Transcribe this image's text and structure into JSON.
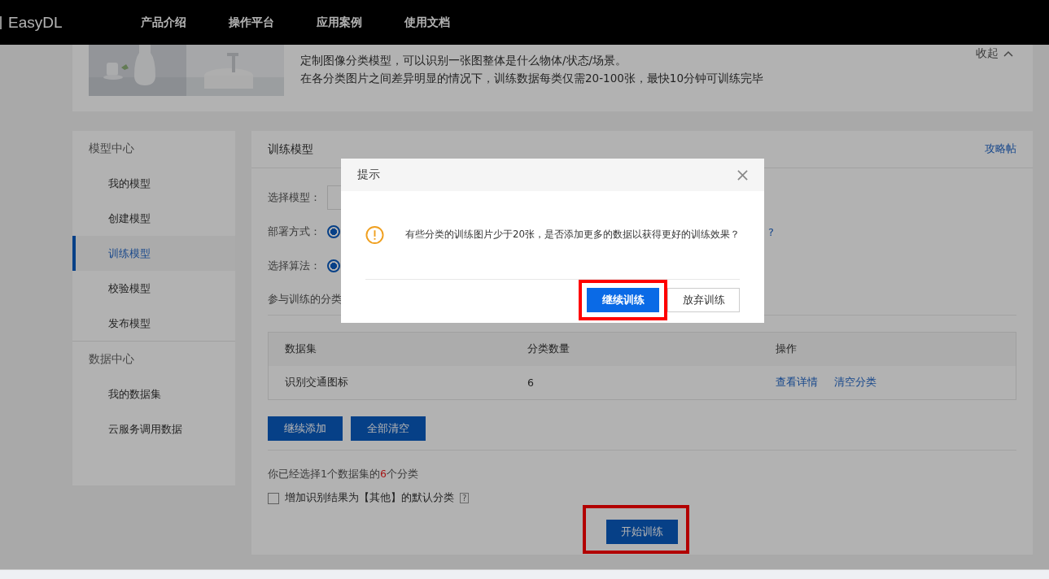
{
  "nav": {
    "brand": "EasyDL",
    "items": [
      "产品介绍",
      "操作平台",
      "应用案例",
      "使用文档"
    ]
  },
  "banner": {
    "kind": "picture",
    "lines": [
      "定制图像分类模型，可以识别一张图整体是什么物体/状态/场景。",
      "在各分类图片之间差异明显的情况下，训练数据每类仅需20-100张，最快10分钟可训练完毕"
    ],
    "collapse": "收起"
  },
  "sidebar": [
    {
      "label": "模型中心",
      "children": [
        {
          "label": "我的模型",
          "selected": false
        },
        {
          "label": "创建模型",
          "selected": false
        },
        {
          "label": "训练模型",
          "selected": true
        },
        {
          "label": "校验模型",
          "selected": false
        },
        {
          "label": "发布模型",
          "selected": false
        }
      ]
    },
    {
      "label": "数据中心",
      "children": [
        {
          "label": "我的数据集",
          "selected": false
        },
        {
          "label": "云服务调用数据",
          "selected": false
        }
      ]
    }
  ],
  "main": {
    "title": "训练模型",
    "guide_link": "攻略帖",
    "form": [
      {
        "kind": "select",
        "label": "选择模型："
      },
      {
        "kind": "radio",
        "label": "部署方式：",
        "checked": true,
        "help": "?"
      },
      {
        "kind": "radio",
        "label": "选择算法：",
        "checked": true
      }
    ],
    "section_label": "参与训练的分类",
    "table": {
      "columns": [
        "数据集",
        "分类数量",
        "操作"
      ],
      "rows": [
        {
          "dataset": "识别交通图标",
          "count": "6",
          "actions": [
            "查看详情",
            "清空分类"
          ]
        }
      ]
    },
    "buttons": [
      "继续添加",
      "全部清空"
    ],
    "summary": {
      "before": "你已经选择1个数据集的",
      "count": "6",
      "after": "个分类"
    },
    "default_class": {
      "label": "增加识别结果为【其他】的默认分类",
      "checked": false,
      "help": "?"
    },
    "start_button": {
      "label": "开始训练",
      "highlighted": true
    }
  },
  "modal": {
    "title": "提示",
    "message": "有些分类的训练图片少于20张，是否添加更多的数据以获得更好的训练效果？",
    "buttons": [
      {
        "kind": "primary",
        "label": "继续训练",
        "highlighted": true
      },
      {
        "kind": "secondary",
        "label": "放弃训练",
        "highlighted": false
      }
    ]
  }
}
